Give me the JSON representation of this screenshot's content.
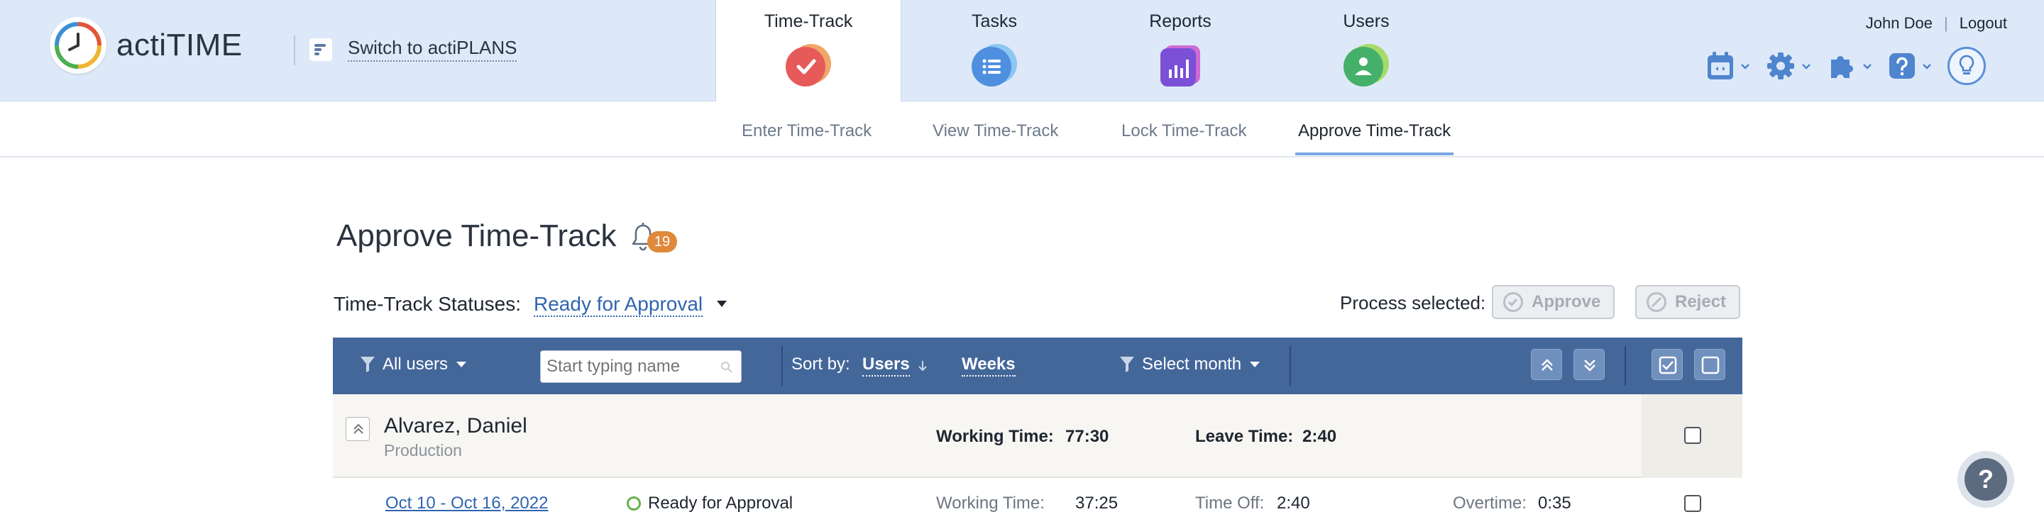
{
  "app": {
    "logo_text": "actiTIME",
    "switch_label": "Switch to actiPLANS"
  },
  "tabs": [
    {
      "label": "Time-Track",
      "icon": "check-icon",
      "color": "#e65a5a"
    },
    {
      "label": "Tasks",
      "icon": "list-icon",
      "color": "#4f8fe0"
    },
    {
      "label": "Reports",
      "icon": "bar-chart-icon",
      "color": "#7b4fd6"
    },
    {
      "label": "Users",
      "icon": "user-icon",
      "color": "#45b06a"
    }
  ],
  "user": {
    "name": "John Doe",
    "logout": "Logout"
  },
  "subnav": {
    "items": [
      "Enter Time-Track",
      "View Time-Track",
      "Lock Time-Track",
      "Approve Time-Track"
    ],
    "active": "Approve Time-Track"
  },
  "page": {
    "title": "Approve Time-Track",
    "notification_count": "19"
  },
  "status_filter": {
    "label": "Time-Track Statuses:",
    "value": "Ready for Approval"
  },
  "process": {
    "label": "Process selected:",
    "approve": "Approve",
    "reject": "Reject"
  },
  "toolbar": {
    "users_filter": "All users",
    "search_placeholder": "Start typing name",
    "sort_label": "Sort by:",
    "sort_value": "Users",
    "group_value": "Weeks",
    "month_filter": "Select month"
  },
  "group": {
    "name": "Alvarez, Daniel",
    "department": "Production",
    "working_time_label": "Working Time:",
    "working_time": "77:30",
    "leave_time_label": "Leave Time:",
    "leave_time": "2:40"
  },
  "rows": [
    {
      "week": "Oct 10 - Oct 16, 2022",
      "status": "Ready for Approval",
      "working_time_label": "Working Time:",
      "working_time": "37:25",
      "time_off_label": "Time Off:",
      "time_off": "2:40",
      "overtime_label": "Overtime:",
      "overtime": "0:35"
    }
  ],
  "help": {
    "label": "?"
  }
}
